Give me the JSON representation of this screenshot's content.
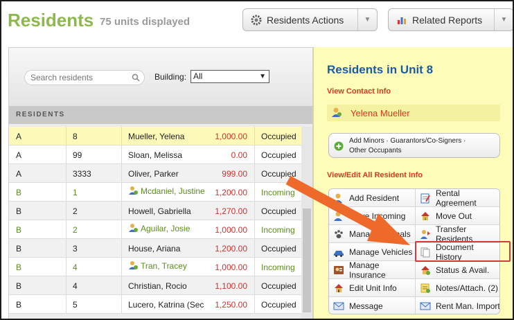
{
  "header": {
    "title": "Residents",
    "units_displayed": "75 units displayed",
    "actions_button": "Residents Actions",
    "reports_button": "Related Reports"
  },
  "search": {
    "placeholder": "Search residents",
    "building_label": "Building:",
    "building_value": "All"
  },
  "table": {
    "section_header": "RESIDENTS",
    "rows": [
      {
        "building": "A",
        "unit": "8",
        "name": "Mueller, Yelena",
        "amount": "1,000.00",
        "status": "Occupied"
      },
      {
        "building": "A",
        "unit": "99",
        "name": "Sloan, Melissa",
        "amount": "0.00",
        "status": "Occupied"
      },
      {
        "building": "A",
        "unit": "3333",
        "name": "Oliver, Parker",
        "amount": "999.00",
        "status": "Occupied"
      },
      {
        "building": "B",
        "unit": "1",
        "name": "Mcdaniel, Justine",
        "amount": "1,200.00",
        "status": "Incoming"
      },
      {
        "building": "B",
        "unit": "2",
        "name": "Howell, Gabriella",
        "amount": "1,270.00",
        "status": "Occupied"
      },
      {
        "building": "B",
        "unit": "2",
        "name": "Aguilar, Josie",
        "amount": "1,000.00",
        "status": "Incoming"
      },
      {
        "building": "B",
        "unit": "3",
        "name": "House, Ariana",
        "amount": "1,200.00",
        "status": "Occupied"
      },
      {
        "building": "B",
        "unit": "4",
        "name": "Tran, Tracey",
        "amount": "1,000.00",
        "status": "Incoming"
      },
      {
        "building": "B",
        "unit": "4",
        "name": "Christian, Rocio",
        "amount": "1,100.00",
        "status": "Occupied"
      },
      {
        "building": "B",
        "unit": "5",
        "name": "Lucero, Katrina (Sec",
        "amount": "1,250.00",
        "status": "Occupied"
      }
    ]
  },
  "unit_panel": {
    "title": "Residents in Unit 8",
    "contact_link": "View Contact Info",
    "tenant_name": "Yelena Mueller",
    "minors_line1": "Add Minors · Guarantors/Co-Signers ·",
    "minors_line2": "Other Occupants",
    "edit_link": "View/Edit All Resident Info",
    "actions": {
      "add_resident": "Add Resident",
      "rental_agreement": "Rental Agreement",
      "move_in": "Move Incoming",
      "move_out": "Move Out",
      "manage_animals": "Manage Animals",
      "transfer_residents": "Transfer Residents",
      "manage_vehicles": "Manage Vehicles",
      "document_history": "Document History",
      "manage_insurance": "Manage Insurance",
      "status_avail": "Status & Avail.",
      "edit_unit_info": "Edit Unit Info",
      "notes_attach": "Notes/Attach. (2)",
      "message": "Message",
      "rent_man_import": "Rent Man. Import"
    }
  },
  "colors": {
    "title_green": "#8cb94b",
    "link_red": "#d33a1d",
    "heading_blue": "#1d5aa6",
    "panel_yellow": "#fdfdb9",
    "arrow_orange": "#ee6a2a",
    "highlight_red": "#d8393b"
  }
}
